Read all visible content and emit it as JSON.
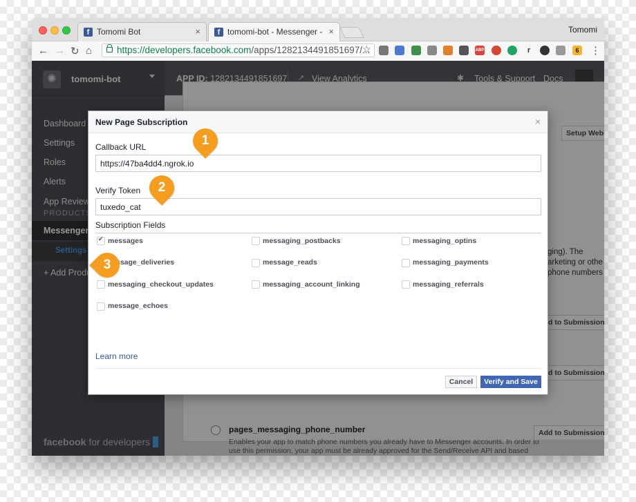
{
  "browser": {
    "tabs": [
      {
        "title": "Tomomi Bot",
        "close": "×"
      },
      {
        "title": "tomomi-bot - Messenger - Fac",
        "close": "×"
      }
    ],
    "profile": "Tomomi",
    "url_scheme_host": "https://developers.facebook.com",
    "url_path": "/apps/1282134491851697/...",
    "ext_labels": [
      "ABP",
      "r",
      "6"
    ]
  },
  "sidebar": {
    "app_name": "tomomi-bot",
    "items": [
      "Dashboard",
      "Settings",
      "Roles",
      "Alerts",
      "App Review"
    ],
    "products_heading": "PRODUCTS",
    "messenger": "Messenger",
    "messenger_settings": "Settings",
    "add_product": "+ Add Produ",
    "footer_brand": "facebook",
    "footer_suffix": " for developers"
  },
  "header": {
    "app_id_label": "APP ID:",
    "app_id_value": " 1282134491851697",
    "view_analytics": "View Analytics",
    "tools_support": "Tools & Support",
    "docs": "Docs"
  },
  "background": {
    "setup_webhooks": "Setup Webh",
    "text_line1": "ging). The",
    "text_line2": "arketing or othe",
    "text_line3": "phone numbers",
    "add_btn1": "d to Submission",
    "add_btn2": "d to Submission",
    "perm_name": "pages_messaging_phone_number",
    "perm_desc": "Enables your app to match phone numbers you already have to Messenger accounts. In order to use this permission, your app must be already approved for the Send/Receive API and based",
    "add_btn3": "Add to Submission"
  },
  "modal": {
    "title": "New Page Subscription",
    "close": "×",
    "callback_label": "Callback URL",
    "callback_value": "https://47ba4dd4.ngrok.io",
    "token_label": "Verify Token",
    "token_value": "tuxedo_cat",
    "fields_label": "Subscription Fields",
    "fields": [
      {
        "label": "messages",
        "checked": true
      },
      {
        "label": "messaging_postbacks",
        "checked": false
      },
      {
        "label": "messaging_optins",
        "checked": false
      },
      {
        "label": "ssage_deliveries",
        "checked": false
      },
      {
        "label": "message_reads",
        "checked": false
      },
      {
        "label": "messaging_payments",
        "checked": false
      },
      {
        "label": "messaging_checkout_updates",
        "checked": false
      },
      {
        "label": "messaging_account_linking",
        "checked": false
      },
      {
        "label": "messaging_referrals",
        "checked": false
      },
      {
        "label": "message_echoes",
        "checked": false
      }
    ],
    "learn_more": "Learn more",
    "cancel": "Cancel",
    "verify_save": "Verify and Save"
  },
  "markers": [
    "1",
    "2",
    "3"
  ],
  "colors": {
    "accent": "#4267b2",
    "marker": "#f59d1e",
    "sidebar": "#4a4d52",
    "link": "#365899"
  }
}
